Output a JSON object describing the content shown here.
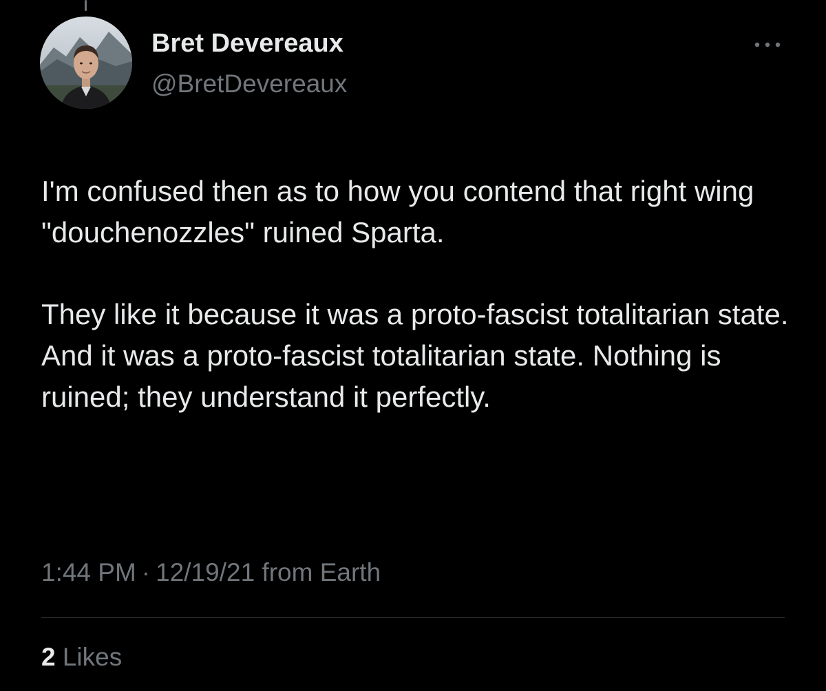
{
  "author": {
    "display_name": "Bret Devereaux",
    "handle": "@BretDevereaux",
    "avatar_icon": "profile-photo"
  },
  "tweet": {
    "paragraphs": [
      "I'm confused then as to how you contend that right wing \"douchenozzles\" ruined Sparta.",
      "They like it because it was a proto-fascist totalitarian state. And it was a proto-fascist totalitarian state.  Nothing is ruined; they understand it perfectly."
    ]
  },
  "meta": {
    "time": "1:44 PM",
    "separator": "·",
    "date": "12/19/21",
    "source": "from Earth"
  },
  "stats": {
    "likes_count": "2",
    "likes_label": "Likes"
  },
  "icons": {
    "more": "more-horizontal-icon"
  },
  "colors": {
    "background": "#000000",
    "primary_text": "#e7e9ea",
    "secondary_text": "#71767b",
    "divider": "#2f3336"
  }
}
